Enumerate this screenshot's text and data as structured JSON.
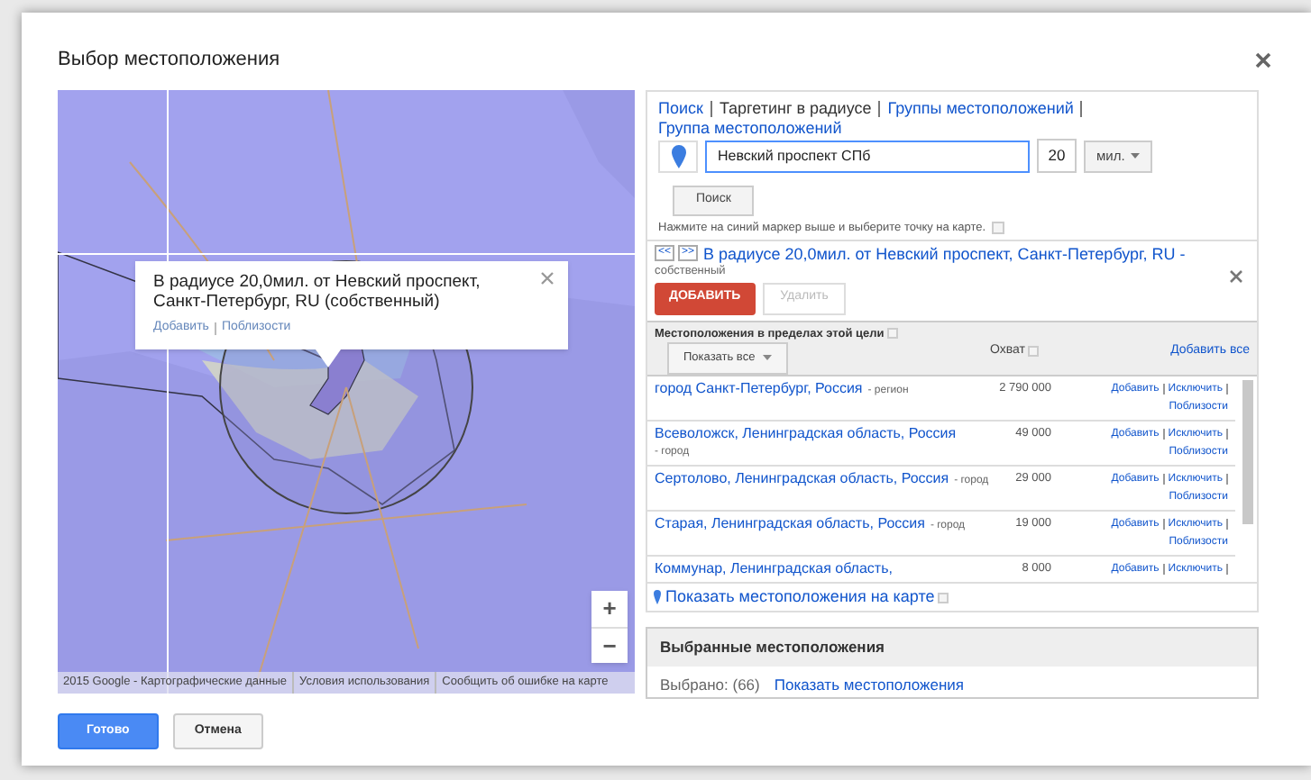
{
  "dialog": {
    "title": "Выбор местоположения"
  },
  "map": {
    "popup": {
      "title": "В радиусе 20,0мил. от Невский проспект, Санкт-Петербург, RU (собственный)",
      "links": [
        "Добавить",
        "Поблизости"
      ]
    },
    "zoom": [
      "+",
      "−"
    ],
    "attribution": [
      "2015 Google - Картографические данные",
      "Условия использования",
      "Сообщить об ошибке на карте"
    ]
  },
  "tabs": [
    {
      "label": "Поиск",
      "selected": false
    },
    {
      "label": "Таргетинг в радиусе",
      "selected": true
    },
    {
      "label": "Группы местоположений",
      "selected": false
    },
    {
      "label": "Группа местоположений",
      "selected": false
    }
  ],
  "search": {
    "value": "Невский проспект СПб",
    "radius": "20",
    "unit": "мил.",
    "button": "Поиск",
    "hint": "Нажмите на синий маркер выше и выберите точку на карте."
  },
  "result": {
    "prev": "<<",
    "next": ">>",
    "title": "В радиусе 20,0мил. от Невский проспект, Санкт-Петербург, RU -",
    "subtitle": "собственный",
    "add": "ДОБАВИТЬ",
    "remove": {
      "label": "Удалить",
      "disabled": true
    }
  },
  "table": {
    "heading": "Местоположения в пределах этой цели",
    "filter": "Показать все",
    "reach_header": "Охват",
    "add_all": "Добавить все",
    "rows": [
      {
        "name": "город Санкт-Петербург, Россия",
        "type": "- регион",
        "reach": "2 790 000",
        "actions": [
          "Добавить",
          "Исключить",
          "Поблизости"
        ]
      },
      {
        "name": "Всеволожск, Ленинградская область, Россия",
        "type": "- город",
        "reach": "49 000",
        "actions": [
          "Добавить",
          "Исключить",
          "Поблизости"
        ]
      },
      {
        "name": "Сертолово, Ленинградская область, Россия",
        "type": "- город",
        "reach": "29 000",
        "actions": [
          "Добавить",
          "Исключить",
          "Поблизости"
        ]
      },
      {
        "name": "Старая, Ленинградская область, Россия",
        "type": "- город",
        "reach": "19 000",
        "actions": [
          "Добавить",
          "Исключить",
          "Поблизости"
        ]
      },
      {
        "name": "Коммунар, Ленинградская область,",
        "reach": "8 000",
        "actions": [
          "Добавить",
          "Исключить"
        ]
      }
    ],
    "map_link": "Показать местоположения на карте"
  },
  "selected_panel": {
    "title": "Выбранные местоположения",
    "count_label": "Выбрано:",
    "count": "(66)",
    "link": "Показать местоположения"
  },
  "footer": {
    "buttons": [
      {
        "label": "Готово",
        "kind": "primary"
      },
      {
        "label": "Отмена",
        "kind": "secondary"
      }
    ]
  }
}
